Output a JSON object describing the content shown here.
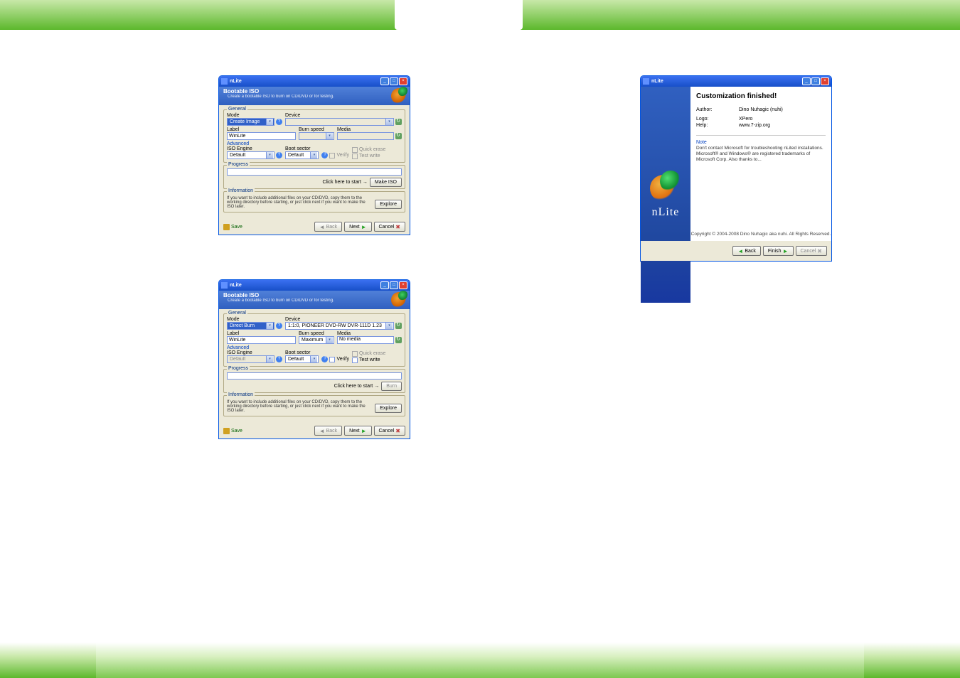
{
  "app": {
    "title": "nLite",
    "logo_text": "nLite"
  },
  "bootable": {
    "title": "Bootable ISO",
    "subtitle": "Create a bootable ISO to burn on CD/DVD or for testing."
  },
  "groups": {
    "general": "General",
    "advanced": "Advanced",
    "progress": "Progress",
    "information": "Information"
  },
  "labels": {
    "mode": "Mode",
    "device": "Device",
    "label": "Label",
    "burn_speed": "Burn speed",
    "media": "Media",
    "iso_engine": "ISO Engine",
    "boot_sector": "Boot sector",
    "click_to_start": "Click here to start →"
  },
  "checkboxes": {
    "quick_erase": "Quick erase",
    "verify": "Verify",
    "test_write": "Test write"
  },
  "values1": {
    "mode": "Create Image",
    "label": "WinLite",
    "device": "",
    "burn_speed": "",
    "media": "",
    "iso_engine": "Default",
    "boot_sector": "Default",
    "action_button": "Make ISO"
  },
  "values2": {
    "mode": "Direct Burn",
    "label": "WinLite",
    "device": "1:1:0, PIONEER  DVD-RW  DVR-111D 1.23",
    "burn_speed": "Maximum",
    "media": "No media",
    "iso_engine": "Default",
    "boot_sector": "Default",
    "action_button": "Burn"
  },
  "info_text": "If you want to include additional files on your CD/DVD, copy them to the working directory before starting, or just click next if you want to make the ISO later.",
  "buttons": {
    "explore": "Explore",
    "save": "Save",
    "back": "Back",
    "next": "Next",
    "cancel": "Cancel",
    "finish": "Finish"
  },
  "finish": {
    "title": "Customization finished!",
    "author_label": "Author:",
    "author_value": "Dino Nuhagic (nuhi)",
    "logo_label": "Logo:",
    "logo_value": "XPero",
    "help_label": "Help:",
    "help_value": "www.7-zip.org",
    "note_title": "Note",
    "note_body": "Don't contact Microsoft for troubleshooting nLited installations. Microsoft® and Windows® are registered trademarks of Microsoft Corp.\nAlso thanks to...",
    "copyright": "Copyright © 2004-2008 Dino Nuhagic aka nuhi. All Rights Reserved."
  }
}
